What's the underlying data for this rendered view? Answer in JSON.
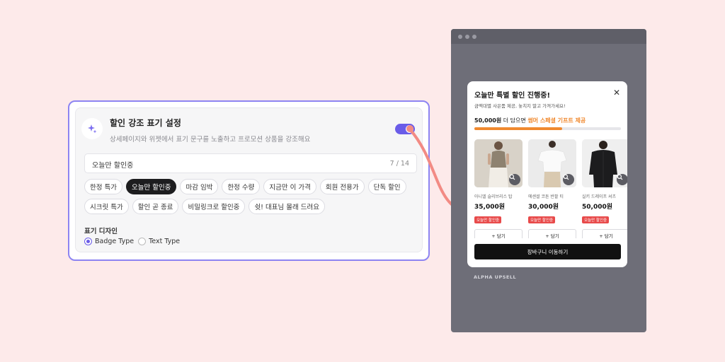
{
  "settings": {
    "title": "할인 강조 표기 설정",
    "description": "상세페이지와 위젯에서 표기 문구를 노출하고 프로모션 상품을 강조해요",
    "enabled": true,
    "input_value": "오늘만 할인중",
    "counter": "7 / 14",
    "chips": [
      "한정 특가",
      "오늘만 할인중",
      "마감 임박",
      "한정 수량",
      "지금만 이 가격",
      "회원 전용가",
      "단독 할인",
      "시크릿 특가",
      "할인 곧 종료",
      "비밀링크로 할인중",
      "쉿! 대표님 몰래 드려요"
    ],
    "active_chip_index": 1,
    "design_label": "표기 디자인",
    "design_options": [
      "Badge Type",
      "Text Type"
    ],
    "selected_design_index": 0
  },
  "modal": {
    "title": "오늘만 특별 할인 진행중!",
    "close_icon": "close-icon",
    "subtitle": "금액대별 사은품 제공, 놓치지 말고 가져가세요!",
    "progress": {
      "amount": "50,000원",
      "middle": " 더 담으면 ",
      "highlight": "썸머 스페셜 기프트 제공",
      "fraction": 0.6,
      "color": "#f0892f"
    },
    "products": [
      {
        "name": "아니엘 슬리브리스 탑",
        "price": "35,000원",
        "badge": "오늘만 할인중",
        "add_label": "+ 담기"
      },
      {
        "name": "에센셜 코튼 반팔 티",
        "price": "30,000원",
        "badge": "오늘만 할인중",
        "add_label": "+ 담기"
      },
      {
        "name": "실키 드레이프 셔츠",
        "price": "50,000원",
        "badge": "오늘만 할인중",
        "add_label": "+ 담기"
      }
    ],
    "cart_button": "장바구니 이동하기"
  },
  "brand": "ALPHA UPSELL",
  "colors": {
    "accent": "#6a5ce8",
    "badge": "#e84a4a",
    "arrow": "#f28b84",
    "background": "#fdeaea"
  }
}
